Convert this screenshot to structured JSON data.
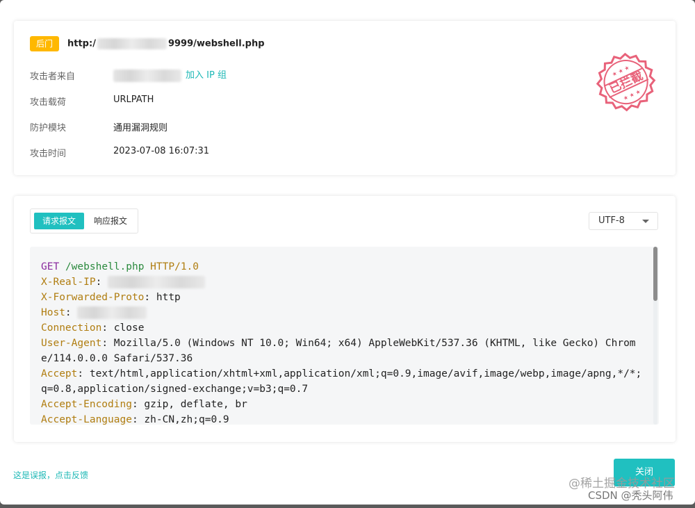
{
  "attack": {
    "badge": "后门",
    "url_prefix": "http:/",
    "url_suffix": "9999/webshell.php",
    "rows": [
      {
        "label": "攻击者来自",
        "value": ""
      },
      {
        "label": "攻击载荷",
        "value": "URLPATH"
      },
      {
        "label": "防护模块",
        "value": "通用漏洞规则"
      },
      {
        "label": "攻击时间",
        "value": "2023-07-08 16:07:31"
      }
    ],
    "add_ip_group": "加入 IP 组",
    "stamp_text": "已拦截",
    "stamp_color": "#e8627a"
  },
  "message": {
    "tabs": [
      {
        "label": "请求报文",
        "active": true
      },
      {
        "label": "响应报文",
        "active": false
      }
    ],
    "encoding": "UTF-8",
    "request": {
      "method": "GET",
      "path": "/webshell.php",
      "protocol": "HTTP/1.0",
      "headers": [
        {
          "name": "X-Real-IP",
          "sep": ":",
          "value": ""
        },
        {
          "name": "X-Forwarded-Proto",
          "sep": ":",
          "value": " http"
        },
        {
          "name": "Host",
          "sep": ":",
          "value": ""
        },
        {
          "name": "Connection",
          "sep": ":",
          "value": " close"
        },
        {
          "name": "User-Agent",
          "sep": ":",
          "value": " Mozilla/5.0 (Windows NT 10.0; Win64; x64) AppleWebKit/537.36 (KHTML, like Gecko) Chrome/114.0.0.0 Safari/537.36"
        },
        {
          "name": "Accept",
          "sep": ":",
          "value": " text/html,application/xhtml+xml,application/xml;q=0.9,image/avif,image/webp,image/apng,*/*;q=0.8,application/signed-exchange;v=b3;q=0.7"
        },
        {
          "name": "Accept-Encoding",
          "sep": ":",
          "value": " gzip, deflate, br"
        },
        {
          "name": "Accept-Language",
          "sep": ":",
          "value": " zh-CN,zh;q=0.9"
        }
      ]
    }
  },
  "footer": {
    "feedback": "这是误报，点击反馈",
    "close": "关闭"
  },
  "watermark": {
    "line1": "@稀土掘金技术社区",
    "line2": "CSDN @秃头阿伟"
  },
  "colors": {
    "accent": "#20c0c0",
    "badge": "#ffb800"
  }
}
